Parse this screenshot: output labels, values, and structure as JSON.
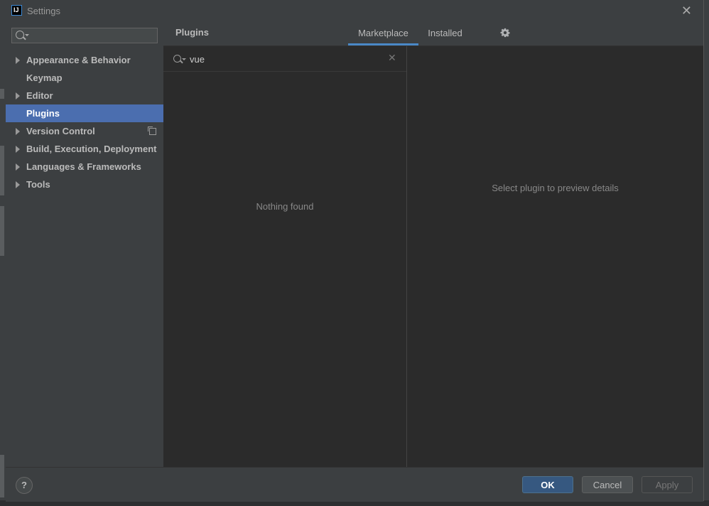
{
  "window": {
    "title": "Settings"
  },
  "search": {
    "placeholder": ""
  },
  "sidebar": {
    "items": [
      {
        "label": "Appearance & Behavior"
      },
      {
        "label": "Keymap"
      },
      {
        "label": "Editor"
      },
      {
        "label": "Plugins"
      },
      {
        "label": "Version Control"
      },
      {
        "label": "Build, Execution, Deployment"
      },
      {
        "label": "Languages & Frameworks"
      },
      {
        "label": "Tools"
      }
    ]
  },
  "main": {
    "title": "Plugins",
    "tabs": [
      {
        "label": "Marketplace"
      },
      {
        "label": "Installed"
      }
    ],
    "plugin_search_value": "vue",
    "empty_text": "Nothing found",
    "preview_text": "Select plugin to preview details"
  },
  "footer": {
    "help": "?",
    "ok": "OK",
    "cancel": "Cancel",
    "apply": "Apply"
  },
  "colors": {
    "accent": "#4b6eaf",
    "tab_underline": "#4a88c7",
    "ok_button": "#365880"
  }
}
